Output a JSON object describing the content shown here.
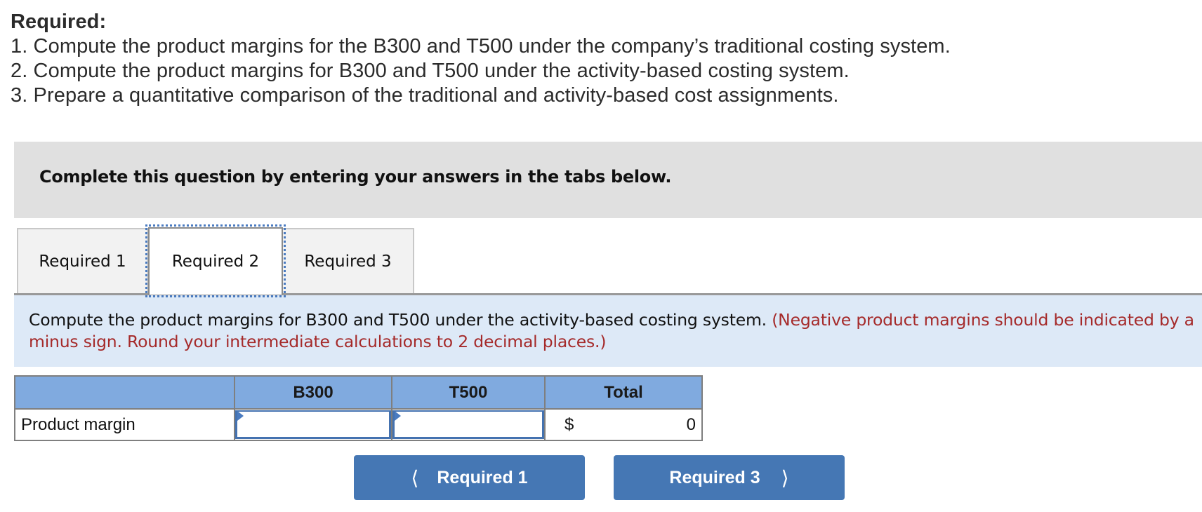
{
  "required": {
    "title": "Required:",
    "items": [
      "1. Compute the product margins for the B300 and T500 under the company’s traditional costing system.",
      "2. Compute the product margins for B300 and T500 under the activity-based costing system.",
      "3. Prepare a quantitative comparison of the traditional and activity-based cost assignments."
    ]
  },
  "banner": {
    "text": "Complete this question by entering your answers in the tabs below."
  },
  "tabs": [
    {
      "label": "Required 1",
      "active": false
    },
    {
      "label": "Required 2",
      "active": true
    },
    {
      "label": "Required 3",
      "active": false
    }
  ],
  "instruction": {
    "text": "Compute the product margins for B300 and T500 under the activity-based costing system.",
    "note": "(Negative product margins should be indicated by a minus sign. Round your intermediate calculations to 2 decimal places.)"
  },
  "table": {
    "headers": [
      "",
      "B300",
      "T500",
      "Total"
    ],
    "rows": [
      {
        "label": "Product margin",
        "b300_value": "",
        "t500_value": "",
        "total_currency": "$",
        "total_value": "0"
      }
    ]
  },
  "navigation": {
    "prev_label": "Required 1",
    "next_label": "Required 3",
    "prev_icon": "chevron-left-icon",
    "next_icon": "chevron-right-icon"
  },
  "colors": {
    "header_blue": "#80aadf",
    "button_blue": "#4577b4",
    "instruction_bg": "#dde9f7",
    "note_red": "#a52a2a",
    "banner_gray": "#e0e0e0"
  }
}
